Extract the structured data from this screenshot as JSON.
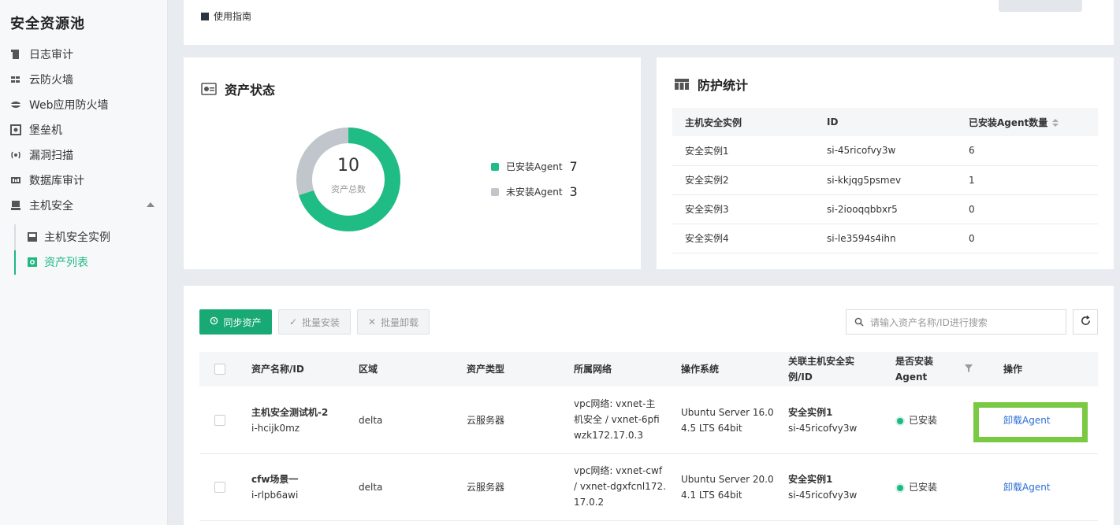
{
  "sidebar": {
    "title": "安全资源池",
    "items": [
      {
        "label": "日志审计",
        "icon": "log-audit-icon"
      },
      {
        "label": "云防火墙",
        "icon": "cloud-firewall-icon"
      },
      {
        "label": "Web应用防火墙",
        "icon": "waf-icon"
      },
      {
        "label": "堡垒机",
        "icon": "bastion-icon"
      },
      {
        "label": "漏洞扫描",
        "icon": "vuln-scan-icon"
      },
      {
        "label": "数据库审计",
        "icon": "db-audit-icon"
      },
      {
        "label": "主机安全",
        "icon": "host-security-icon"
      }
    ],
    "subitems": [
      {
        "label": "主机安全实例",
        "icon": "host-instance-icon"
      },
      {
        "label": "资产列表",
        "icon": "asset-list-icon",
        "active": true
      }
    ]
  },
  "guide": {
    "label": "使用指南"
  },
  "asset_status": {
    "title": "资产状态",
    "total": "10",
    "total_label": "资产总数",
    "legend": [
      {
        "label": "已安装Agent",
        "value": "7",
        "color": "#1fbc85"
      },
      {
        "label": "未安装Agent",
        "value": "3",
        "color": "#c0c6cc"
      }
    ]
  },
  "protection": {
    "title": "防护统计",
    "headers": [
      "主机安全实例",
      "ID",
      "已安装Agent数量"
    ],
    "rows": [
      [
        "安全实例1",
        "si-45ricofvy3w",
        "6"
      ],
      [
        "安全实例2",
        "si-kkjqg5psmev",
        "1"
      ],
      [
        "安全实例3",
        "si-2iooqqbbxr5",
        "0"
      ],
      [
        "安全实例4",
        "si-le3594s4ihn",
        "0"
      ]
    ]
  },
  "toolbar": {
    "sync": "同步资产",
    "batch_install": "批量安装",
    "batch_uninstall": "批量卸载",
    "search_placeholder": "请输入资产名称/ID进行搜索"
  },
  "assets": {
    "headers": {
      "name": "资产名称/ID",
      "region": "区域",
      "type": "资产类型",
      "network": "所属网络",
      "os": "操作系统",
      "instance_l1": "关联主机安全实",
      "instance_l2": "例/ID",
      "agent_l1": "是否安装",
      "agent_l2": "Agent",
      "action": "操作"
    },
    "rows": [
      {
        "name": "主机安全测试机-2",
        "id": "i-hcijk0mz",
        "region": "delta",
        "type": "云服务器",
        "net1": "vpc网络: vxnet-主",
        "net2": "机安全 / vxnet-6pfi",
        "net3": "wzk172.17.0.3",
        "os1": "Ubuntu Server 16.0",
        "os2": "4.5 LTS 64bit",
        "inst": "安全实例1",
        "inst_id": "si-45ricofvy3w",
        "agent": "已安装",
        "action": "卸载Agent"
      },
      {
        "name": "cfw场景一",
        "id": "i-rlpb6awi",
        "region": "delta",
        "type": "云服务器",
        "net1": "vpc网络: vxnet-cwf",
        "net2": "/ vxnet-dgxfcnl172.",
        "net3": "17.0.2",
        "os1": "Ubuntu Server 20.0",
        "os2": "4.1 LTS 64bit",
        "inst": "安全实例1",
        "inst_id": "si-45ricofvy3w",
        "agent": "已安装",
        "action": "卸载Agent"
      }
    ]
  },
  "colors": {
    "accent": "#1fb981",
    "highlight": "#7ac943",
    "link": "#2b6fd6"
  }
}
